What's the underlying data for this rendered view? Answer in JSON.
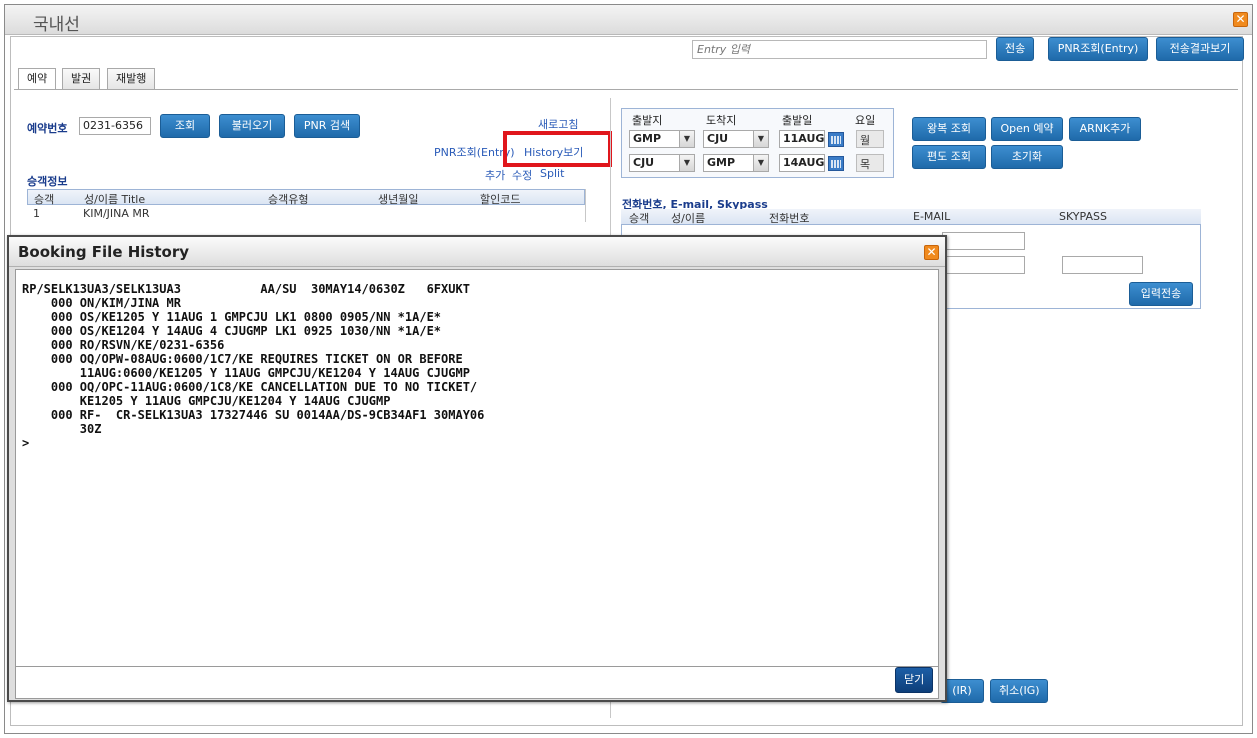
{
  "window": {
    "title": "국내선"
  },
  "toolbar": {
    "entry_placeholder": "Entry 입력",
    "send_label": "전송",
    "pnr_entry_label": "PNR조회(Entry)",
    "result_label": "전송결과보기"
  },
  "tabs": [
    "예약",
    "발권",
    "재발행"
  ],
  "booking": {
    "number_label": "예약번호",
    "number_value": "0231-6356",
    "btn_search": "조회",
    "btn_load": "불러오기",
    "btn_pnr_search": "PNR 검색",
    "refresh": "새로고침",
    "pnr_entry": "PNR조회(Entry)",
    "history": "History보기"
  },
  "passenger": {
    "section_label": "승객정보",
    "actions": [
      "추가",
      "수정",
      "Split"
    ],
    "columns": [
      "승객",
      "성/이름 Title",
      "승객유형",
      "생년월일",
      "할인코드"
    ],
    "rows": [
      [
        "1",
        "KIM/JINA MR",
        "",
        "",
        ""
      ]
    ]
  },
  "route": {
    "headers": [
      "출발지",
      "도착지",
      "출발일",
      "요일"
    ],
    "rows": [
      {
        "from": "GMP",
        "to": "CJU",
        "date": "11AUG",
        "dow": "월"
      },
      {
        "from": "CJU",
        "to": "GMP",
        "date": "14AUG",
        "dow": "목"
      }
    ]
  },
  "actions": {
    "roundtrip": "왕복 조회",
    "open_booking": "Open 예약",
    "arnk": "ARNK추가",
    "oneway": "편도 조회",
    "reset": "초기화"
  },
  "contact": {
    "section_label": "전화번호, E-mail, Skypass",
    "columns": [
      "승객",
      "성/이름",
      "전화번호",
      "E-MAIL",
      "SKYPASS"
    ],
    "submit": "입력전송"
  },
  "bottom": {
    "ir": "(IR)",
    "ig": "취소(IG)"
  },
  "modal": {
    "title": "Booking File History",
    "close_label": "닫기",
    "lines": [
      "RP/SELK13UA3/SELK13UA3           AA/SU  30MAY14/0630Z   6FXUKT",
      "    000 ON/KIM/JINA MR",
      "    000 OS/KE1205 Y 11AUG 1 GMPCJU LK1 0800 0905/NN *1A/E*",
      "    000 OS/KE1204 Y 14AUG 4 CJUGMP LK1 0925 1030/NN *1A/E*",
      "    000 RO/RSVN/KE/0231-6356",
      "    000 OQ/OPW-08AUG:0600/1C7/KE REQUIRES TICKET ON OR BEFORE",
      "        11AUG:0600/KE1205 Y 11AUG GMPCJU/KE1204 Y 14AUG CJUGMP",
      "    000 OQ/OPC-11AUG:0600/1C8/KE CANCELLATION DUE TO NO TICKET/",
      "        KE1205 Y 11AUG GMPCJU/KE1204 Y 14AUG CJUGMP",
      "    000 RF-  CR-SELK13UA3 17327446 SU 0014AA/DS-9CB34AF1 30MAY06",
      "        30Z",
      ">"
    ]
  }
}
